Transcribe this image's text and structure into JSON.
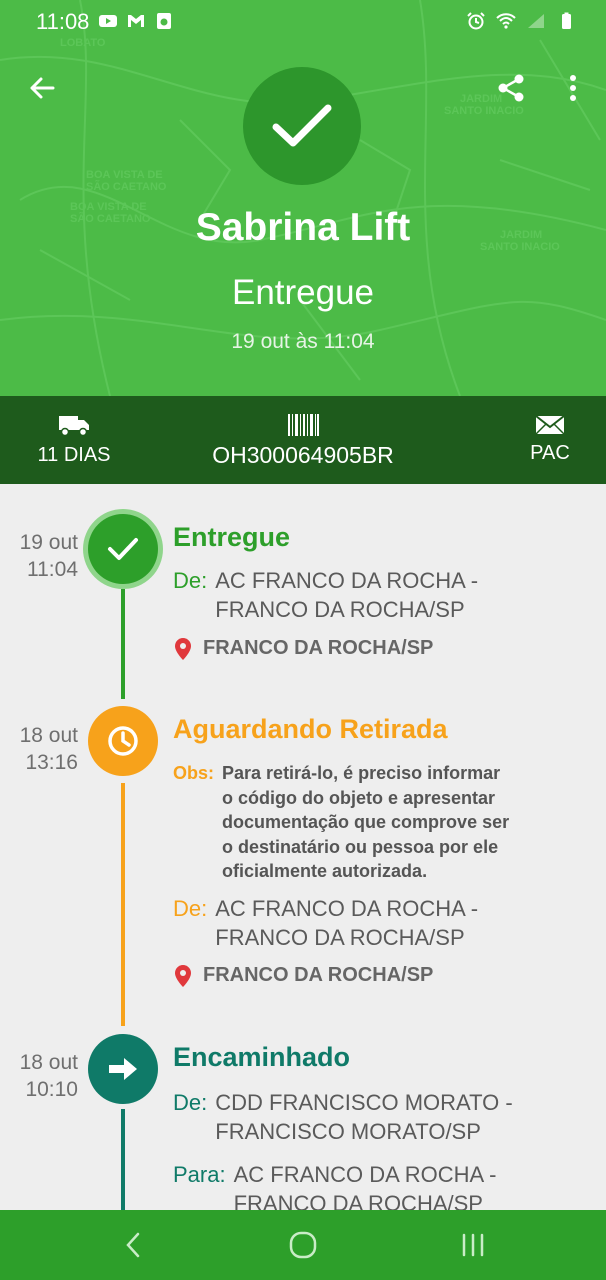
{
  "status_bar": {
    "time": "11:08"
  },
  "header": {
    "recipient_name": "Sabrina Lift",
    "status": "Entregue",
    "status_date": "19 out às 11:04"
  },
  "info_bar": {
    "days": "11 DIAS",
    "tracking_code": "OH300064905BR",
    "service": "PAC"
  },
  "colors": {
    "header_green": "#4cbb47",
    "dark_green": "#1e5b1c",
    "delivered_green": "#2d9f2a",
    "waiting_orange": "#f7a21b",
    "forwarded_teal": "#0f7a68"
  },
  "events": [
    {
      "date": "19 out",
      "time": "11:04",
      "title": "Entregue",
      "icon": "check-icon",
      "from_label": "De:",
      "from_line1": "AC FRANCO DA ROCHA -",
      "from_line2": "FRANCO DA ROCHA/SP",
      "place": "FRANCO DA ROCHA/SP"
    },
    {
      "date": "18 out",
      "time": "13:16",
      "title": "Aguardando Retirada",
      "icon": "clock-icon",
      "obs_label": "Obs:",
      "obs_lines": [
        "Para retirá-lo, é preciso informar",
        "o código do objeto e apresentar",
        "documentação que comprove ser",
        "o destinatário ou pessoa por ele",
        "oficialmente autorizada."
      ],
      "from_label": "De:",
      "from_line1": "AC FRANCO DA ROCHA -",
      "from_line2": "FRANCO DA ROCHA/SP",
      "place": "FRANCO DA ROCHA/SP"
    },
    {
      "date": "18 out",
      "time": "10:10",
      "title": "Encaminhado",
      "icon": "arrow-right-icon",
      "from_label": "De:",
      "from_line1": "CDD FRANCISCO MORATO -",
      "from_line2": "FRANCISCO MORATO/SP",
      "to_label": "Para:",
      "to_line1": "AC FRANCO DA ROCHA -",
      "to_line2": "FRANCO DA ROCHA/SP"
    }
  ]
}
